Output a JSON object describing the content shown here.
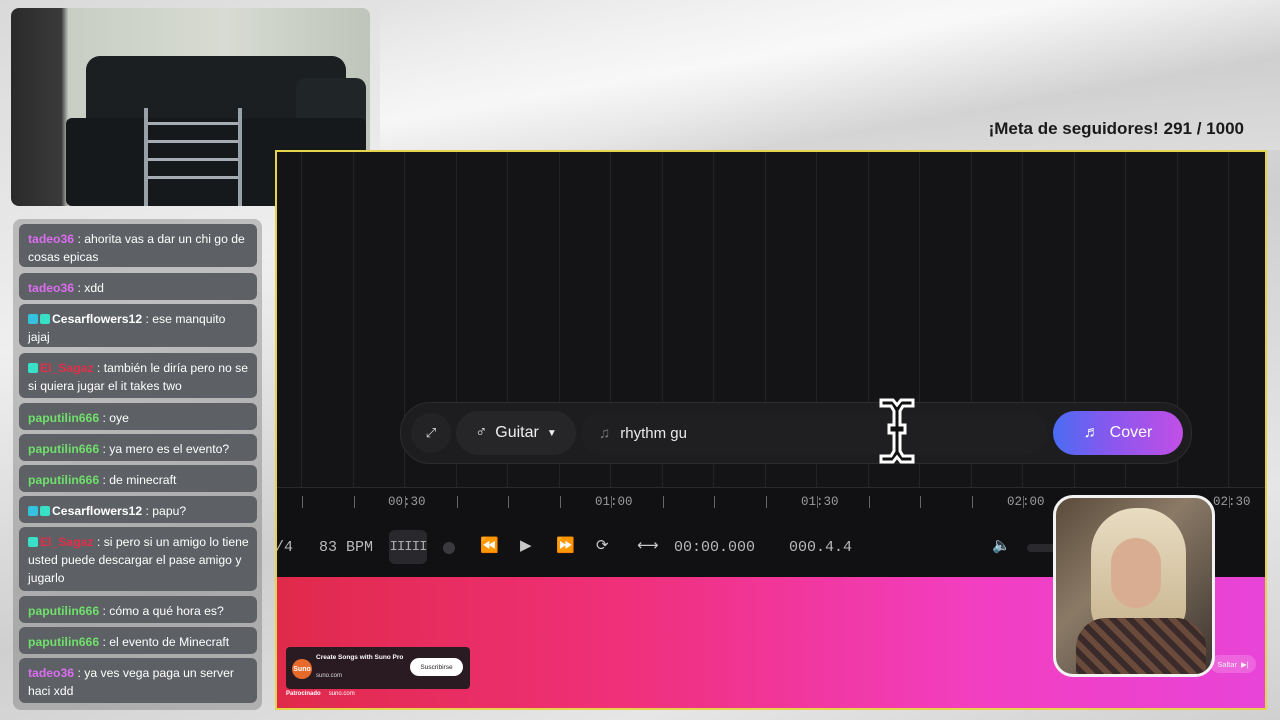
{
  "goal": {
    "label": "¡Meta de seguidores!",
    "count": "291 / 1000"
  },
  "chat": [
    {
      "user": "tadeo36",
      "class": "u-tadeo",
      "badges": 0,
      "text": "ahorita vas a dar un chi go de cosas epicas"
    },
    {
      "user": "tadeo36",
      "class": "u-tadeo",
      "badges": 0,
      "text": "xdd"
    },
    {
      "user": "Cesarflowers12",
      "class": "u-cesar",
      "badges": 2,
      "text": "ese manquito jajaj"
    },
    {
      "user": "El_Sagaz",
      "class": "u-sagaz",
      "badges": 1,
      "text": "también le diría pero no se si quiera jugar el it takes two"
    },
    {
      "user": "paputilin666",
      "class": "u-paputi",
      "badges": 0,
      "text": "oye"
    },
    {
      "user": "paputilin666",
      "class": "u-paputi",
      "badges": 0,
      "text": "ya mero es el evento?"
    },
    {
      "user": "paputilin666",
      "class": "u-paputi",
      "badges": 0,
      "text": "de minecraft"
    },
    {
      "user": "Cesarflowers12",
      "class": "u-cesar",
      "badges": 2,
      "text": "papu?"
    },
    {
      "user": "El_Sagaz",
      "class": "u-sagaz",
      "badges": 1,
      "text": "si pero si un amigo lo tiene usted puede descargar el pase amigo y jugarlo"
    },
    {
      "user": "paputilin666",
      "class": "u-paputi",
      "badges": 0,
      "text": "cómo a qué hora es?"
    },
    {
      "user": "paputilin666",
      "class": "u-paputi",
      "badges": 0,
      "text": "el evento de Minecraft"
    },
    {
      "user": "tadeo36",
      "class": "u-tadeo",
      "badges": 0,
      "text": "ya ves vega paga un server haci xdd"
    }
  ],
  "prompt": {
    "instrument": "Guitar",
    "input_value": "rhythm gu",
    "cover_label": "Cover",
    "icons": {
      "expand": "expand-icon",
      "instrument": "guitar-icon",
      "note": "music-note-icon",
      "cover": "music-note-icon"
    }
  },
  "timeline": {
    "labels": [
      "00:30",
      "01:00",
      "01:30",
      "02:00",
      "02:30"
    ]
  },
  "transport": {
    "time_sig": "/4",
    "bpm": "83 BPM",
    "metronome": "IIIII",
    "time": "00:00.000",
    "position": "000.4.4",
    "icons": [
      "rewind-icon",
      "play-icon",
      "fast-forward-icon",
      "loop-icon",
      "snap-icon",
      "volume-icon"
    ]
  },
  "ad": {
    "logo": "Suno",
    "title": "Create Songs with Suno Pro",
    "url": "suno.com",
    "subscribe": "Suscribirse",
    "sponsored": "Patrocinado",
    "sponsor_url": "suno.com",
    "skip": "Saltar"
  }
}
